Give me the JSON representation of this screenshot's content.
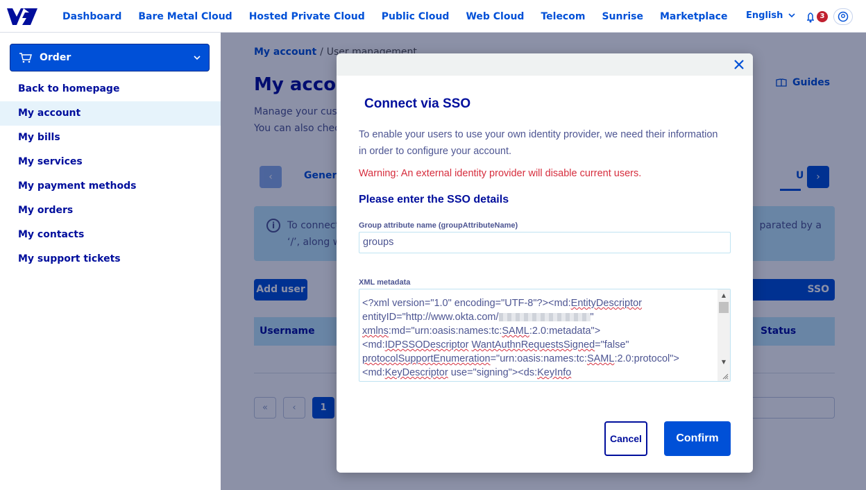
{
  "nav": {
    "items": [
      "Dashboard",
      "Bare Metal Cloud",
      "Hosted Private Cloud",
      "Public Cloud",
      "Web Cloud",
      "Telecom",
      "Sunrise",
      "Marketplace"
    ],
    "language": "English",
    "notification_count": "3"
  },
  "sidebar": {
    "order_label": "Order",
    "items": [
      {
        "label": "Back to homepage"
      },
      {
        "label": "My account"
      },
      {
        "label": "My bills"
      },
      {
        "label": "My services"
      },
      {
        "label": "My payment methods"
      },
      {
        "label": "My orders"
      },
      {
        "label": "My contacts"
      },
      {
        "label": "My support tickets"
      }
    ]
  },
  "main": {
    "breadcrumb_root": "My account",
    "breadcrumb_sep": "/",
    "breadcrumb_current": "User management",
    "title": "My accou",
    "guides": "Guides",
    "desc_line1": "Manage your custo",
    "desc_line2": "You can also chec",
    "tab_general": "Genera",
    "tab_users": "U",
    "info_line1": "To connect",
    "info_line1_end": "parated by a",
    "info_line2": "‘/’, along w",
    "add_user": "Add user",
    "sso_connection": "SSO connection",
    "col_username": "Username",
    "col_status": "Status",
    "pager": [
      "«",
      "‹",
      "1"
    ]
  },
  "modal": {
    "title": "Connect via SSO",
    "intro": "To enable your users to use your own identity provider, we need their information in order to configure your account.",
    "warning": "Warning: An external identity provider will disable current users.",
    "subtitle": "Please enter the SSO details",
    "group_label": "Group attribute name (groupAttributeName)",
    "group_value": "groups",
    "xml_label": "XML metadata",
    "xml": {
      "l1a": "<?xml version=\"1.0\" encoding=\"UTF-8\"?><md:",
      "l1b": "EntityDescriptor",
      "l2a": "entityID=\"http://www.okta.com/",
      "l2b": "\"",
      "l3a": "xmlns",
      "l3b": ":md=\"urn:oasis:names:tc:",
      "l3c": "SAML",
      "l3d": ":2.0:metadata\">",
      "l4a": "<md:",
      "l4b": "IDPSSODescriptor",
      "l4c": " ",
      "l4d": "WantAuthnRequestsSigned",
      "l4e": "=\"false\"",
      "l5a": "protocolSupportEnumeration",
      "l5b": "=\"urn:oasis:names:tc:",
      "l5c": "SAML",
      "l5d": ":2.0:protocol\">",
      "l6a": "<md:",
      "l6b": "KeyDescriptor",
      "l6c": " use=\"signing\"><ds:",
      "l6d": "KeyInfo"
    },
    "cancel": "Cancel",
    "confirm": "Confirm"
  },
  "colors": {
    "primary": "#0050d7",
    "navy": "#000e9c",
    "warning": "#d62d3d",
    "info_bg": "#bfe9fb"
  }
}
